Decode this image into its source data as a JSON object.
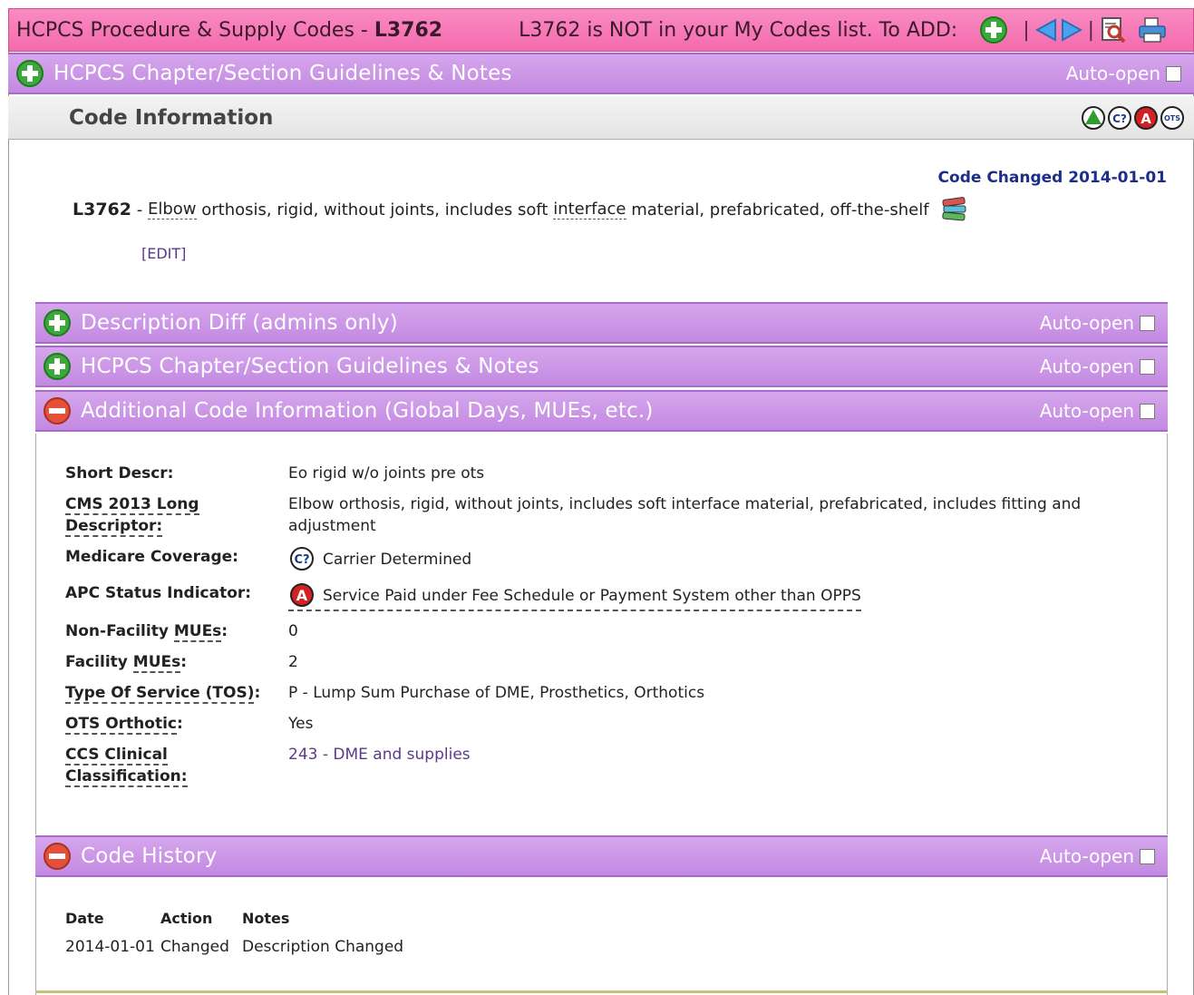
{
  "titlebar": {
    "title_prefix": "HCPCS Procedure & Supply Codes - ",
    "title_code": "L3762",
    "notice": "L3762 is NOT in your My Codes list. To ADD:",
    "sep1": "|",
    "sep2": "|",
    "icons": [
      "add-icon",
      "prev-arrow-icon",
      "next-arrow-icon",
      "search-document-icon",
      "print-icon"
    ]
  },
  "top_bar": {
    "label": "HCPCS Chapter/Section Guidelines & Notes",
    "auto_open": "Auto-open"
  },
  "code_info": {
    "label": "Code Information",
    "legend_icons": [
      "green-triangle-icon",
      "carrier-determined-icon",
      "apc-a-icon",
      "ots-icon"
    ],
    "changed": "Code Changed 2014-01-01",
    "code": "L3762",
    "dash": " - ",
    "desc_part1": "Elbow",
    "desc_part2": " orthosis, rigid, without joints, includes soft ",
    "desc_part3": "interface",
    "desc_part4": " material, prefabricated, off-the-shelf",
    "edit": "[EDIT]"
  },
  "sections": [
    {
      "label": "Description Diff (admins only)",
      "auto_open": "Auto-open",
      "state": "collapsed"
    },
    {
      "label": "HCPCS Chapter/Section Guidelines & Notes",
      "auto_open": "Auto-open",
      "state": "collapsed"
    },
    {
      "label": "Additional Code Information (Global Days, MUEs, etc.)",
      "auto_open": "Auto-open",
      "state": "expanded"
    }
  ],
  "additional": {
    "short_descr_k": "Short Descr:",
    "short_descr_v": "Eo rigid w/o joints pre ots",
    "cms_k": "CMS 2013 Long Descriptor:",
    "cms_v": "Elbow orthosis, rigid, without joints, includes soft interface material, prefabricated, includes fitting and adjustment",
    "coverage_k": "Medicare Coverage:",
    "coverage_v": "Carrier Determined",
    "apc_k": "APC Status Indicator:",
    "apc_v": "Service Paid under Fee Schedule or Payment System other than OPPS",
    "nonfac_k1": "Non-Facility ",
    "nonfac_k2": "MUEs",
    "nonfac_k3": ":",
    "nonfac_v": "0",
    "fac_k1": "Facility ",
    "fac_k2": "MUEs",
    "fac_k3": ":",
    "fac_v": "2",
    "tos_k": "Type Of Service (TOS)",
    "tos_k2": ":",
    "tos_v": "P - Lump Sum Purchase of DME, Prosthetics, Orthotics",
    "ots_k": "OTS Orthotic",
    "ots_k2": ":",
    "ots_v": "Yes",
    "ccs_k": "CCS Clinical Classification:",
    "ccs_v": "243 - DME and supplies"
  },
  "history": {
    "label": "Code History",
    "auto_open": "Auto-open",
    "headers": [
      "Date",
      "Action",
      "Notes"
    ],
    "rows": [
      [
        "2014-01-01",
        "Changed",
        "Description Changed"
      ]
    ]
  },
  "colors": {
    "title_pink": "#f46bad",
    "section_purple": "#c389e2",
    "link": "#5a3a8a",
    "changed_blue": "#1c2e8a"
  }
}
